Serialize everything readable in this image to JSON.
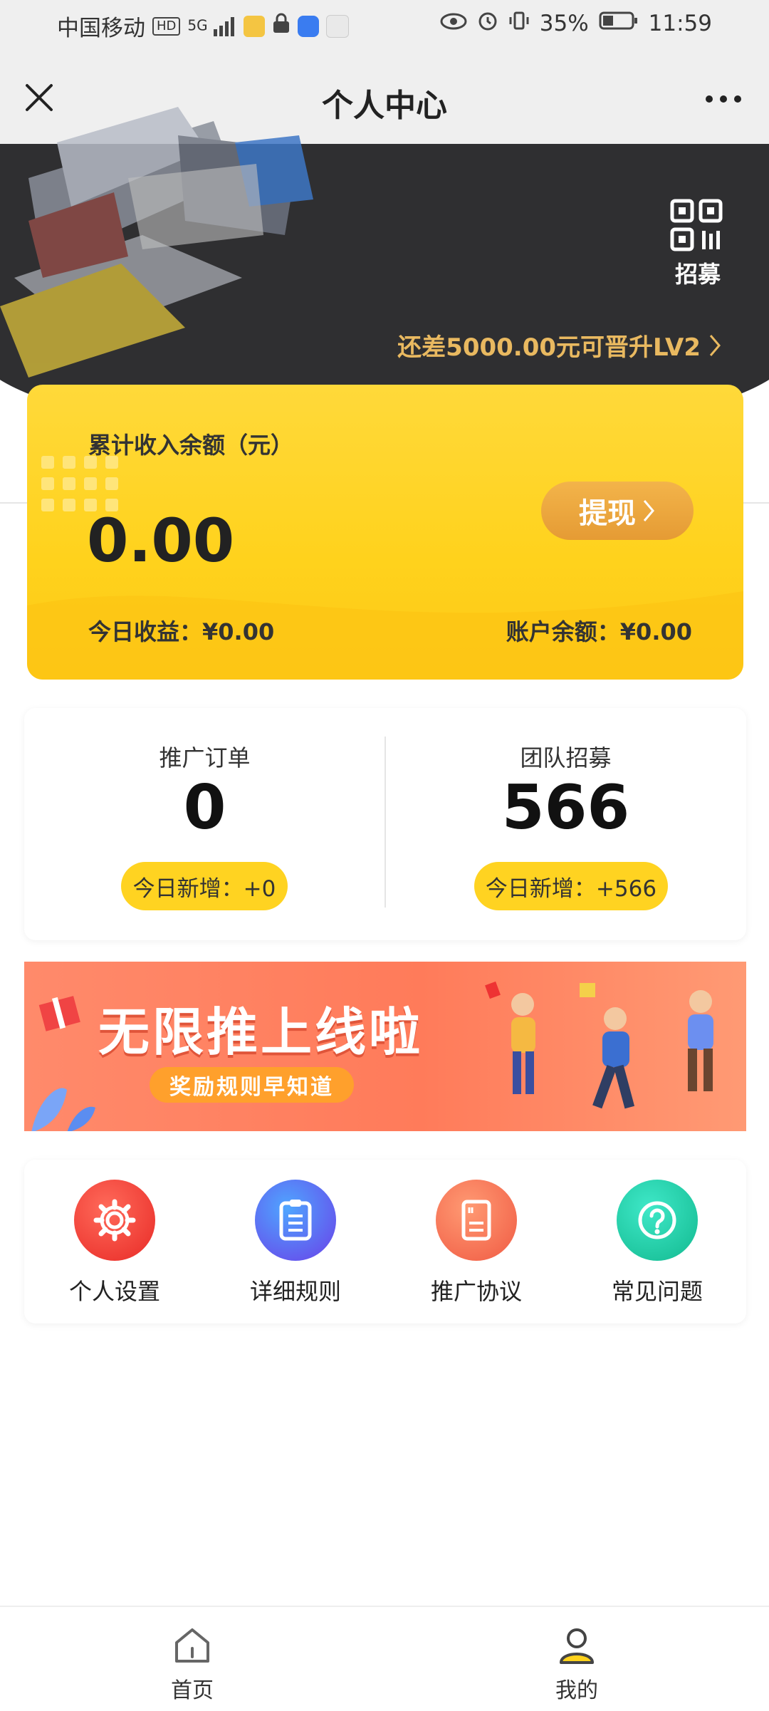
{
  "status_bar": {
    "carrier": "中国移动",
    "hd": "HD",
    "signal": "5G",
    "battery": "35%",
    "time": "11:59"
  },
  "nav": {
    "title": "个人中心",
    "close_icon": "close-icon",
    "more_icon": "more-icon"
  },
  "header": {
    "recruit_label": "招募",
    "upgrade_text": "还差5000.00元可晋升LV2"
  },
  "earnings": {
    "cumulative_label": "累计收入余额（元）",
    "cumulative_value": "0.00",
    "withdraw_label": "提现",
    "today_label": "今日收益：",
    "today_value": "¥0.00",
    "account_label": "账户余额：",
    "account_value": "¥0.00"
  },
  "stats": [
    {
      "label": "推广订单",
      "value": "0",
      "today": "今日新增：+0"
    },
    {
      "label": "团队招募",
      "value": "566",
      "today": "今日新增：+566"
    }
  ],
  "banner": {
    "title": "无限推上线啦",
    "subtitle": "奖励规则早知道"
  },
  "menu": [
    {
      "label": "个人设置",
      "icon": "gear-icon",
      "color": "#f2453d"
    },
    {
      "label": "详细规则",
      "icon": "document-icon",
      "color": "#5a55f0"
    },
    {
      "label": "推广协议",
      "icon": "contract-icon",
      "color": "#f46a4e"
    },
    {
      "label": "常见问题",
      "icon": "question-icon",
      "color": "#1fcfa9"
    }
  ],
  "tabbar": [
    {
      "label": "首页",
      "icon": "home-icon"
    },
    {
      "label": "我的",
      "icon": "profile-icon"
    }
  ],
  "colors": {
    "accent_yellow": "#ffd21c",
    "dark_header": "#2f2f31",
    "gold_text": "#e9b960"
  }
}
